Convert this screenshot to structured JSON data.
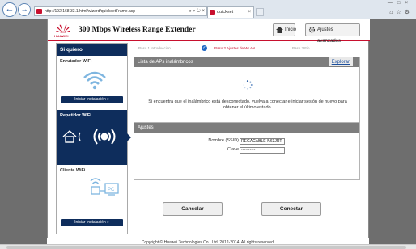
{
  "browser": {
    "address": "http://192.168.33.1/html/wizard/quicksetFrame.asp",
    "tab_title": "quickset",
    "back_icon": "back-arrow-icon",
    "forward_icon": "forward-arrow-icon"
  },
  "header": {
    "brand": "HUAWEI",
    "product_title": "300 Mbps Wireless Range Extender",
    "home_label": "Inicio",
    "advanced_label": "Ajustes avanzados"
  },
  "sidebar": {
    "title": "Si quiero",
    "sections": [
      {
        "label": "Enrutador WiFi",
        "button": "Iniciar Instalación  »",
        "icon": "wifi-icon"
      },
      {
        "label": "Repetidor WiFi",
        "button": "",
        "icon": "repeater-icon"
      },
      {
        "label": "Cliente WiFi",
        "button": "Iniciar Instalación  »",
        "icon": "pc-client-icon"
      }
    ]
  },
  "steps": [
    {
      "label": "Paso 1  Introducción",
      "state": "done"
    },
    {
      "label": "Paso 2  Ajustes de WLAN",
      "state": "active"
    },
    {
      "label": "Paso 3  Fin",
      "state": "pending"
    }
  ],
  "ap_panel": {
    "title": "Lista de APs inalámbricos",
    "explore_link": "Explorar",
    "notice": "Si encuentra que el inalámbrico está desconectado, vuelva a conectar e iniciar sesión de nuevo para obtener el último estado."
  },
  "settings_panel": {
    "title": "Ajustes",
    "ssid_label": "Nombre (SSID)",
    "ssid_value": "REGACABLE-N63JRT",
    "key_label": "Clave",
    "key_value": "••••••••••"
  },
  "buttons": {
    "cancel": "Cancelar",
    "connect": "Conectar"
  },
  "footer": {
    "copyright": "Copyright © Huawei Technologies Co., Ltd. 2012-2014. All rights reserved."
  },
  "colors": {
    "navy": "#0e2d5c",
    "brand_red": "#c8102e",
    "panel_grey": "#7d7d7d"
  }
}
